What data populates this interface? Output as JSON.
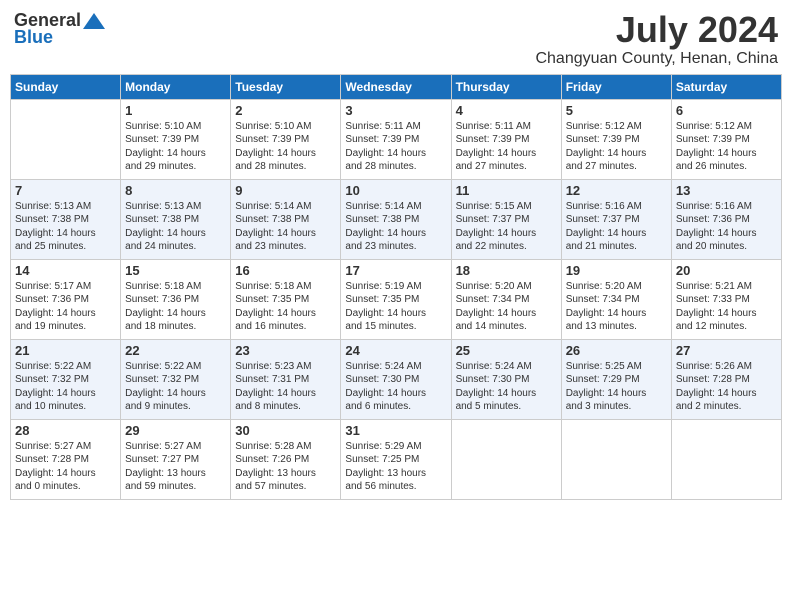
{
  "logo": {
    "general": "General",
    "blue": "Blue"
  },
  "title": "July 2024",
  "location": "Changyuan County, Henan, China",
  "days_of_week": [
    "Sunday",
    "Monday",
    "Tuesday",
    "Wednesday",
    "Thursday",
    "Friday",
    "Saturday"
  ],
  "weeks": [
    [
      {
        "day": "",
        "info": ""
      },
      {
        "day": "1",
        "info": "Sunrise: 5:10 AM\nSunset: 7:39 PM\nDaylight: 14 hours\nand 29 minutes."
      },
      {
        "day": "2",
        "info": "Sunrise: 5:10 AM\nSunset: 7:39 PM\nDaylight: 14 hours\nand 28 minutes."
      },
      {
        "day": "3",
        "info": "Sunrise: 5:11 AM\nSunset: 7:39 PM\nDaylight: 14 hours\nand 28 minutes."
      },
      {
        "day": "4",
        "info": "Sunrise: 5:11 AM\nSunset: 7:39 PM\nDaylight: 14 hours\nand 27 minutes."
      },
      {
        "day": "5",
        "info": "Sunrise: 5:12 AM\nSunset: 7:39 PM\nDaylight: 14 hours\nand 27 minutes."
      },
      {
        "day": "6",
        "info": "Sunrise: 5:12 AM\nSunset: 7:39 PM\nDaylight: 14 hours\nand 26 minutes."
      }
    ],
    [
      {
        "day": "7",
        "info": "Sunrise: 5:13 AM\nSunset: 7:38 PM\nDaylight: 14 hours\nand 25 minutes."
      },
      {
        "day": "8",
        "info": "Sunrise: 5:13 AM\nSunset: 7:38 PM\nDaylight: 14 hours\nand 24 minutes."
      },
      {
        "day": "9",
        "info": "Sunrise: 5:14 AM\nSunset: 7:38 PM\nDaylight: 14 hours\nand 23 minutes."
      },
      {
        "day": "10",
        "info": "Sunrise: 5:14 AM\nSunset: 7:38 PM\nDaylight: 14 hours\nand 23 minutes."
      },
      {
        "day": "11",
        "info": "Sunrise: 5:15 AM\nSunset: 7:37 PM\nDaylight: 14 hours\nand 22 minutes."
      },
      {
        "day": "12",
        "info": "Sunrise: 5:16 AM\nSunset: 7:37 PM\nDaylight: 14 hours\nand 21 minutes."
      },
      {
        "day": "13",
        "info": "Sunrise: 5:16 AM\nSunset: 7:36 PM\nDaylight: 14 hours\nand 20 minutes."
      }
    ],
    [
      {
        "day": "14",
        "info": "Sunrise: 5:17 AM\nSunset: 7:36 PM\nDaylight: 14 hours\nand 19 minutes."
      },
      {
        "day": "15",
        "info": "Sunrise: 5:18 AM\nSunset: 7:36 PM\nDaylight: 14 hours\nand 18 minutes."
      },
      {
        "day": "16",
        "info": "Sunrise: 5:18 AM\nSunset: 7:35 PM\nDaylight: 14 hours\nand 16 minutes."
      },
      {
        "day": "17",
        "info": "Sunrise: 5:19 AM\nSunset: 7:35 PM\nDaylight: 14 hours\nand 15 minutes."
      },
      {
        "day": "18",
        "info": "Sunrise: 5:20 AM\nSunset: 7:34 PM\nDaylight: 14 hours\nand 14 minutes."
      },
      {
        "day": "19",
        "info": "Sunrise: 5:20 AM\nSunset: 7:34 PM\nDaylight: 14 hours\nand 13 minutes."
      },
      {
        "day": "20",
        "info": "Sunrise: 5:21 AM\nSunset: 7:33 PM\nDaylight: 14 hours\nand 12 minutes."
      }
    ],
    [
      {
        "day": "21",
        "info": "Sunrise: 5:22 AM\nSunset: 7:32 PM\nDaylight: 14 hours\nand 10 minutes."
      },
      {
        "day": "22",
        "info": "Sunrise: 5:22 AM\nSunset: 7:32 PM\nDaylight: 14 hours\nand 9 minutes."
      },
      {
        "day": "23",
        "info": "Sunrise: 5:23 AM\nSunset: 7:31 PM\nDaylight: 14 hours\nand 8 minutes."
      },
      {
        "day": "24",
        "info": "Sunrise: 5:24 AM\nSunset: 7:30 PM\nDaylight: 14 hours\nand 6 minutes."
      },
      {
        "day": "25",
        "info": "Sunrise: 5:24 AM\nSunset: 7:30 PM\nDaylight: 14 hours\nand 5 minutes."
      },
      {
        "day": "26",
        "info": "Sunrise: 5:25 AM\nSunset: 7:29 PM\nDaylight: 14 hours\nand 3 minutes."
      },
      {
        "day": "27",
        "info": "Sunrise: 5:26 AM\nSunset: 7:28 PM\nDaylight: 14 hours\nand 2 minutes."
      }
    ],
    [
      {
        "day": "28",
        "info": "Sunrise: 5:27 AM\nSunset: 7:28 PM\nDaylight: 14 hours\nand 0 minutes."
      },
      {
        "day": "29",
        "info": "Sunrise: 5:27 AM\nSunset: 7:27 PM\nDaylight: 13 hours\nand 59 minutes."
      },
      {
        "day": "30",
        "info": "Sunrise: 5:28 AM\nSunset: 7:26 PM\nDaylight: 13 hours\nand 57 minutes."
      },
      {
        "day": "31",
        "info": "Sunrise: 5:29 AM\nSunset: 7:25 PM\nDaylight: 13 hours\nand 56 minutes."
      },
      {
        "day": "",
        "info": ""
      },
      {
        "day": "",
        "info": ""
      },
      {
        "day": "",
        "info": ""
      }
    ]
  ]
}
